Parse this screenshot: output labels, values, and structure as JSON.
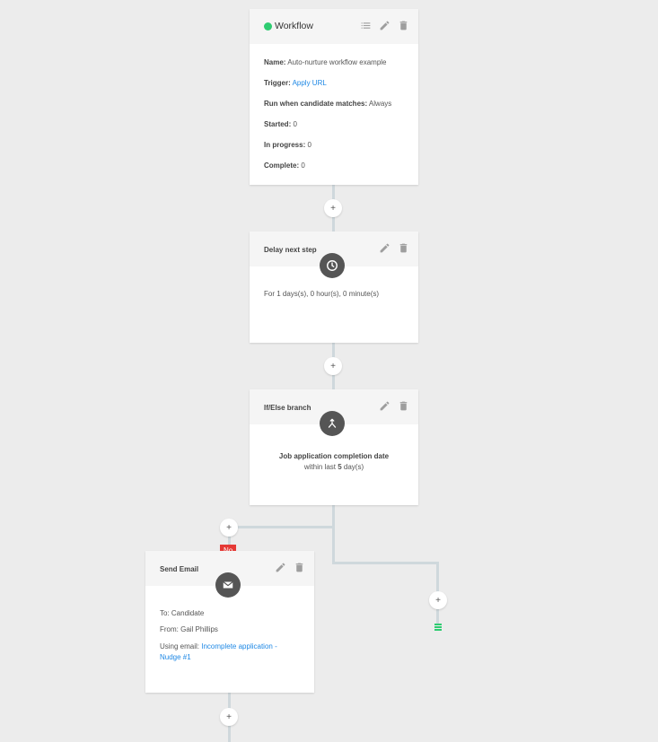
{
  "workflow": {
    "title": "Workflow",
    "name_label": "Name:",
    "name_value": " Auto-nurture workflow example",
    "trigger_label": "Trigger:",
    "trigger_value": "Apply URL",
    "run_label": "Run when candidate matches:",
    "run_value": " Always",
    "started_label": "Started:",
    "started_value": " 0",
    "progress_label": "In progress:",
    "progress_value": " 0",
    "complete_label": "Complete:",
    "complete_value": " 0",
    "status_color": "#2ecc71"
  },
  "delay": {
    "title": "Delay next step",
    "text": "For 1 days(s), 0 hour(s), 0 minute(s)",
    "icon": "clock-icon"
  },
  "branch": {
    "title": "If/Else branch",
    "condition": "Job application completion date",
    "within_prefix": "within last ",
    "within_count": "5",
    "within_suffix": " day(s)",
    "icon": "branch-icon"
  },
  "email": {
    "title": "Send Email",
    "to": "To: Candidate",
    "from": "From: Gail Phillips",
    "using_label": "Using email: ",
    "using_value": "Incomplete application - Nudge #1",
    "icon": "envelope-icon"
  },
  "no_badge": "No",
  "plus_label": "+",
  "colors": {
    "accent_link": "#1e88e5",
    "no_badge": "#e53935",
    "end_marker": "#2ecc71",
    "rail": "#cfd8dc"
  }
}
